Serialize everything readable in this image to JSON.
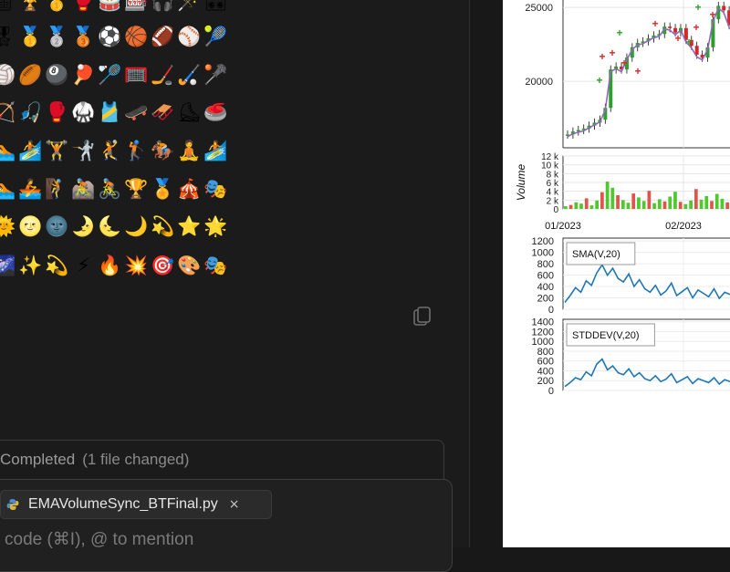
{
  "emoji_grid": {
    "rows": [
      [
        "🎚",
        "🏆",
        "🥇",
        "🥊",
        "🥁",
        "🎰",
        "🎧",
        "🪄",
        "🎛"
      ],
      [
        "🎖",
        "🥇",
        "🥈",
        "🥉",
        "⚽",
        "🏀",
        "🏈",
        "⚾",
        "🎾"
      ],
      [
        "🏐",
        "🏉",
        "🎱",
        "🏓",
        "🏸",
        "🥅",
        "🏒",
        "🏑",
        "🥍"
      ],
      [
        "🏹",
        "🎣",
        "🥊",
        "🥋",
        "🎽",
        "🛹",
        "🛷",
        "⛸",
        "🥌"
      ],
      [
        "🏊",
        "🏄",
        "🏋",
        "🤺",
        "🤾",
        "🏌",
        "🏇",
        "🧘",
        "🏄"
      ],
      [
        "🏊",
        "🚣",
        "🧗",
        "🚵",
        "🚴",
        "🏆",
        "🏅",
        "🎪",
        "🎭"
      ],
      [
        "🌞",
        "🌝",
        "🌚",
        "🌛",
        "🌜",
        "🌙",
        "💫",
        "⭐",
        "🌟"
      ],
      [
        "🌌",
        "✨",
        "💫",
        "⚡",
        "🔥",
        "💥",
        "🎯",
        "🎨",
        "🎭"
      ]
    ]
  },
  "status": {
    "completed": "Completed",
    "changes": "(1 file changed)"
  },
  "composer": {
    "file_name": "EMAVolumeSync_BTFinal.py",
    "close_glyph": "×",
    "placeholder": "code (⌘I), @ to mention"
  },
  "chart": {
    "price_ticks": [
      "25000",
      "20000"
    ],
    "volume_label": "Volume",
    "volume_ticks": [
      "12 k",
      "10 k",
      "8 k",
      "6 k",
      "4 k",
      "2 k",
      "0"
    ],
    "date_ticks": [
      "01/2023",
      "02/2023"
    ],
    "sma_label": "SMA(V,20)",
    "sma_ticks": [
      "1200",
      "1000",
      "800",
      "600",
      "400",
      "200",
      "0"
    ],
    "stddev_label": "STDDEV(V,20)",
    "stddev_ticks": [
      "1400",
      "1200",
      "1000",
      "800",
      "600",
      "400",
      "200",
      "0"
    ],
    "colors": {
      "candle_up": "#2ca02c",
      "candle_down": "#d62728",
      "ma_line": "#9467bd",
      "indicator": "#1f77b4",
      "vol_green": "#4ec92b",
      "vol_red": "#e2534b"
    }
  },
  "chart_data": [
    {
      "type": "line",
      "title": "",
      "ylabel": "",
      "yticks": [
        20000,
        25000
      ],
      "ylim": [
        15500,
        25500
      ],
      "series": [
        {
          "values": [
            16400,
            16600,
            16700,
            16800,
            17000,
            17200,
            17400,
            18200,
            20800,
            21000,
            20800,
            21600,
            22300,
            22600,
            22700,
            22900,
            23100,
            23200,
            23700,
            23600,
            23300,
            23600,
            22800,
            22400,
            21800,
            21600,
            22300,
            24200,
            25100,
            24800,
            23800
          ]
        }
      ]
    },
    {
      "type": "bar",
      "ylabel": "Volume",
      "yticks": [
        0,
        2000,
        4000,
        6000,
        8000,
        10000,
        12000
      ],
      "ylim": [
        0,
        12000
      ],
      "xticks": [
        "01/2023",
        "02/2023"
      ],
      "values": [
        600,
        900,
        1500,
        1200,
        2400,
        800,
        1900,
        3800,
        6200,
        4800,
        3100,
        2000,
        1400,
        3500,
        2600,
        1800,
        4100,
        1300,
        2200,
        1700,
        2800,
        3900,
        1600,
        1100,
        1900,
        4500,
        2100,
        2900,
        1800,
        3400,
        2300,
        1500
      ]
    },
    {
      "type": "line",
      "series_label": "SMA(V,20)",
      "yticks": [
        0,
        200,
        400,
        600,
        800,
        1000,
        1200
      ],
      "ylim": [
        0,
        1250
      ],
      "values": [
        120,
        240,
        380,
        300,
        500,
        420,
        640,
        780,
        600,
        720,
        540,
        480,
        620,
        400,
        520,
        360,
        300,
        420,
        250,
        320,
        460,
        240,
        310,
        380,
        200,
        340,
        280,
        220,
        360,
        190,
        300,
        260
      ]
    },
    {
      "type": "line",
      "series_label": "STDDEV(V,20)",
      "yticks": [
        0,
        200,
        400,
        600,
        800,
        1000,
        1200,
        1400
      ],
      "ylim": [
        0,
        1450
      ],
      "values": [
        80,
        160,
        260,
        220,
        380,
        300,
        540,
        640,
        420,
        500,
        360,
        320,
        440,
        280,
        360,
        240,
        200,
        300,
        180,
        230,
        340,
        160,
        220,
        280,
        140,
        240,
        200,
        160,
        260,
        130,
        220,
        180
      ]
    }
  ]
}
